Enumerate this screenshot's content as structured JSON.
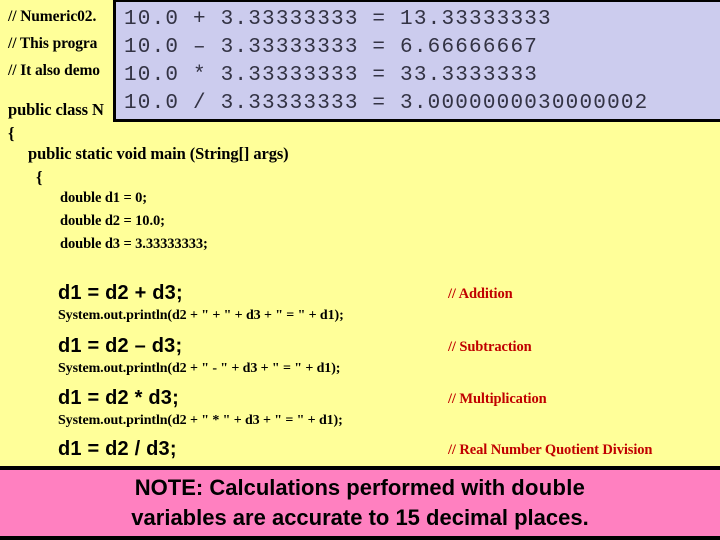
{
  "code": {
    "comments_top": [
      "// Numeric02.",
      "// This progra",
      "// It also demo"
    ],
    "class_decl": "public class N",
    "class_open_brace": "{",
    "main_signature": "public static void main (String[] args)",
    "main_open_brace": "{",
    "declarations": [
      "double d1 = 0;",
      "double d2 = 10.0;",
      "double d3 = 3.33333333;"
    ],
    "statements": [
      {
        "code": "d1 = d2 + d3;",
        "comment": "// Addition",
        "println": "System.out.println(d2 + \" + \" + d3 + \" = \" + d1);"
      },
      {
        "code": "d1 = d2 – d3;",
        "comment": "// Subtraction",
        "println": "System.out.println(d2 + \" - \" + d3 + \" = \" + d1);"
      },
      {
        "code": "d1 = d2 * d3;",
        "comment": "// Multiplication",
        "println": "System.out.println(d2 + \" * \" + d3 + \" = \" + d1);"
      },
      {
        "code": "d1 = d2 / d3;",
        "comment": "// Real Number Quotient Division",
        "println": ""
      }
    ]
  },
  "console": {
    "lines": [
      "10.0 + 3.33333333 = 13.33333333",
      "10.0 – 3.33333333 = 6.66666667",
      "10.0 * 3.33333333 = 33.3333333",
      "10.0 / 3.33333333 = 3.0000000030000002"
    ]
  },
  "note": {
    "line1_prefix": "NOTE: Calculations performed with ",
    "line1_strong": "double",
    "line2": "variables are accurate to 15 decimal places."
  },
  "colors": {
    "code_background": "#FFFF99",
    "console_background": "#CCCCEE",
    "console_border": "#000000",
    "note_background": "#FF80C0",
    "comment_red": "#C00000",
    "slide_background": "#000000"
  }
}
